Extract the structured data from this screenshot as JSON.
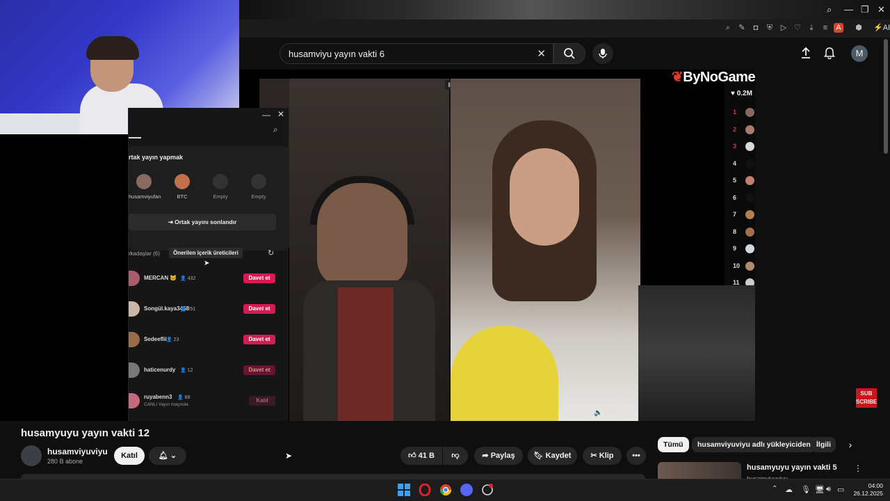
{
  "search": {
    "query": "husamviyu yayın vakti 6"
  },
  "header": {
    "avatar_letter": "M"
  },
  "window_controls": {
    "search": "⌕",
    "minimize": "—",
    "restore": "❐",
    "close": "✕"
  },
  "overlay": {
    "logo": "ByNoGame",
    "likes": "♥ 0.2M",
    "sub_line1": "SUB",
    "sub_line2": "SCRIBE",
    "btc_tag": "BTC"
  },
  "ranks": [
    "1",
    "2",
    "3",
    "4",
    "5",
    "6",
    "7",
    "8",
    "9",
    "10",
    "11"
  ],
  "tiktok": {
    "section_title": "rtak yayın yapmak",
    "slots": [
      {
        "name": "husamviyufan"
      },
      {
        "name": "BTC"
      },
      {
        "name": "Empty"
      },
      {
        "name": "Empty"
      }
    ],
    "end_button": "Ortak yayını sonlandır",
    "friends_tab": "rkadaşlar (6)",
    "suggested_tab": "Önerilen içerik üreticileri",
    "invite_label": "Davet et",
    "join_label": "Katıl",
    "friends": [
      {
        "name": "MERCAN 🐱",
        "count": "432",
        "action": "Davet et"
      },
      {
        "name": "Songül.kaya3458",
        "count": "251",
        "action": "Davet et"
      },
      {
        "name": "Sedeeflii",
        "count": "23",
        "action": "Davet et"
      },
      {
        "name": "haticenurdy",
        "count": "12",
        "action": "Davet et"
      },
      {
        "name": "ruyabenn3",
        "count": "88",
        "sub": "CANLI Yayın maçında",
        "action": "Katıl"
      }
    ]
  },
  "video": {
    "title": "husamyuyu yayın vakti 12"
  },
  "channel": {
    "name": "husamviyuviyu",
    "subs": "280 B abone",
    "join": "Katıl"
  },
  "actions": {
    "likes": "41 B",
    "share": "Paylaş",
    "save": "Kaydet",
    "clip": "Klip"
  },
  "chips": [
    "Tümü",
    "husamviyuviyu adlı yükleyiciden",
    "İlgili"
  ],
  "sidebar_video": {
    "title": "husamyuyu yayın vakti 5",
    "channel": "husamviyuviyu"
  },
  "taskbar": {
    "time": "04:00",
    "date": "26.12.2025"
  }
}
